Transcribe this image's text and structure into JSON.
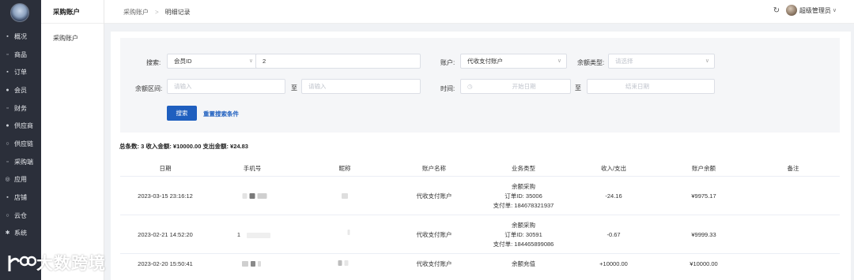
{
  "nav": {
    "items": [
      {
        "icon": "monitor-icon",
        "glyph": "▪",
        "label": "概况"
      },
      {
        "icon": "goods-icon",
        "glyph": "▫",
        "label": "商品"
      },
      {
        "icon": "order-icon",
        "glyph": "▪",
        "label": "订单"
      },
      {
        "icon": "member-icon",
        "glyph": "●",
        "label": "会员"
      },
      {
        "icon": "finance-icon",
        "glyph": "▫",
        "label": "财务"
      },
      {
        "icon": "supplier-icon",
        "glyph": "●",
        "label": "供应商"
      },
      {
        "icon": "supply-chain-icon",
        "glyph": "○",
        "label": "供应链"
      },
      {
        "icon": "purchase-icon",
        "glyph": "▫",
        "label": "采购端"
      },
      {
        "icon": "app-icon",
        "glyph": "◎",
        "label": "应用"
      },
      {
        "icon": "store-icon",
        "glyph": "▪",
        "label": "店铺"
      },
      {
        "icon": "cloud-warehouse-icon",
        "glyph": "○",
        "label": "云仓"
      },
      {
        "icon": "settings-icon",
        "glyph": "✱",
        "label": "系统"
      }
    ]
  },
  "subnav": {
    "title": "采购账户",
    "entry": "采购账户"
  },
  "header": {
    "breadcrumb": [
      "采购账户",
      "明细记录"
    ],
    "separator": ">",
    "refresh_glyph": "↻",
    "fullscreen_glyph": "⛶",
    "user_name": "超级管理员",
    "chevron": "∨"
  },
  "filter": {
    "search_label": "搜索:",
    "search_field_select": "会员ID",
    "search_value": "2",
    "account_label": "账户:",
    "account_select": "代收支付账户",
    "balance_type_label": "余额类型:",
    "balance_type_placeholder": "请选择",
    "balance_range_label": "余额区间:",
    "range_from_placeholder": "请输入",
    "range_to_label": "至",
    "range_to_placeholder": "请输入",
    "time_label": "时间:",
    "start_date_placeholder": "开始日期",
    "time_to_label": "至",
    "end_date_placeholder": "结束日期",
    "arrow": "∨",
    "clock": "◷",
    "search_button": "搜索",
    "reset_link": "重置搜索条件"
  },
  "summary": "总条数: 3  收入金额: ¥10000.00  支出金额: ¥24.83",
  "table": {
    "columns": [
      "日期",
      "手机号",
      "昵称",
      "账户名称",
      "业务类型",
      "收入/支出",
      "账户余额",
      "备注"
    ],
    "rows": [
      {
        "date": "2023-03-15 23:16:12",
        "account": "代收支付账户",
        "biz_type": "余额采购",
        "order_id": "订单ID: 35006",
        "pay_no": "支付单: 184678321937",
        "amount": "-24.16",
        "balance": "¥9975.17"
      },
      {
        "date": "2023-02-21 14:52:20",
        "phone_prefix": "1",
        "account": "代收支付账户",
        "biz_type": "余额采购",
        "order_id": "订单ID: 30591",
        "pay_no": "支付单: 184465899086",
        "amount": "-0.67",
        "balance": "¥9999.33"
      },
      {
        "date": "2023-02-20 15:50:41",
        "account": "代收支付账户",
        "biz_type": "余额充值",
        "amount": "+10000.00",
        "balance": "¥10000.00"
      }
    ]
  },
  "watermark": {
    "text": "大数跨境"
  }
}
